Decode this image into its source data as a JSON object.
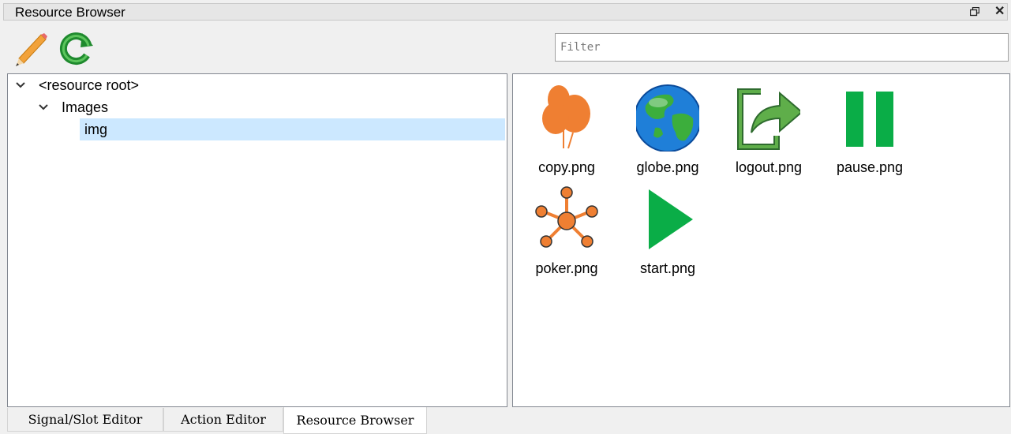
{
  "window": {
    "title": "Resource Browser"
  },
  "toolbar": {
    "edit_icon": "pencil-icon",
    "reload_icon": "reload-icon",
    "filter_placeholder": "Filter"
  },
  "tree": {
    "items": [
      {
        "label": "<resource root>",
        "expanded": true,
        "level": 0
      },
      {
        "label": "Images",
        "expanded": true,
        "level": 1
      },
      {
        "label": "img",
        "selected": true,
        "level": 2
      }
    ]
  },
  "files": [
    {
      "name": "copy.png",
      "icon": "balloons-icon"
    },
    {
      "name": "globe.png",
      "icon": "globe-icon"
    },
    {
      "name": "logout.png",
      "icon": "logout-icon"
    },
    {
      "name": "pause.png",
      "icon": "pause-icon"
    },
    {
      "name": "poker.png",
      "icon": "network-icon"
    },
    {
      "name": "start.png",
      "icon": "play-icon"
    }
  ],
  "tabs": [
    {
      "label": "Signal/Slot Editor",
      "active": false
    },
    {
      "label": "Action Editor",
      "active": false
    },
    {
      "label": "Resource Browser",
      "active": true
    }
  ],
  "colors": {
    "selection": "#cce8ff",
    "orange": "#ef7f32",
    "green": "#0aad47"
  }
}
